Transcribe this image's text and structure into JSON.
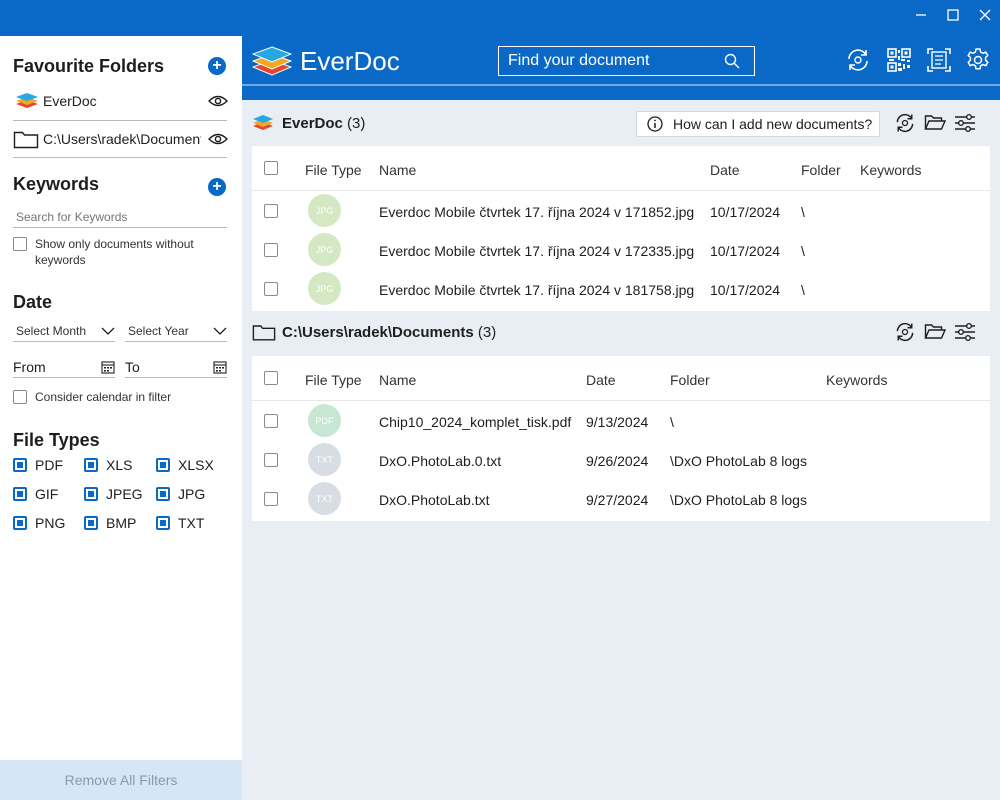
{
  "window": {
    "minimize_glyph": "—",
    "maximize_glyph": "☐",
    "close_glyph": "✕"
  },
  "sidebar": {
    "favourites_title": "Favourite Folders",
    "favourites": [
      {
        "label": "EverDoc",
        "icon": "stack-icon"
      },
      {
        "label": "C:\\Users\\radek\\Documents",
        "icon": "folder-icon"
      }
    ],
    "keywords_title": "Keywords",
    "keywords_placeholder": "Search for Keywords",
    "no_keywords_label": "Show only documents without keywords",
    "date_title": "Date",
    "select_month": "Select Month",
    "select_year": "Select Year",
    "from_label": "From",
    "to_label": "To",
    "consider_calendar": "Consider calendar in filter",
    "file_types_title": "File Types",
    "file_types": [
      "PDF",
      "XLS",
      "XLSX",
      "GIF",
      "JPEG",
      "JPG",
      "PNG",
      "BMP",
      "TXT"
    ],
    "remove_filters": "Remove All Filters"
  },
  "header": {
    "app_name": "EverDoc",
    "search_placeholder": "Find your document"
  },
  "panels": [
    {
      "title": "EverDoc",
      "count": "(3)",
      "help": "How can I add new documents?",
      "columns": [
        "File Type",
        "Name",
        "Date",
        "Folder",
        "Keywords"
      ],
      "rows": [
        {
          "type": "JPG",
          "name": "Everdoc Mobile čtvrtek 17. října 2024 v 171852.jpg",
          "date": "10/17/2024",
          "folder": "\\",
          "keywords": ""
        },
        {
          "type": "JPG",
          "name": "Everdoc Mobile čtvrtek 17. října 2024 v 172335.jpg",
          "date": "10/17/2024",
          "folder": "\\",
          "keywords": ""
        },
        {
          "type": "JPG",
          "name": "Everdoc Mobile čtvrtek 17. října 2024 v 181758.jpg",
          "date": "10/17/2024",
          "folder": "\\",
          "keywords": ""
        }
      ]
    },
    {
      "title": "C:\\Users\\radek\\Documents",
      "count": "(3)",
      "columns": [
        "File Type",
        "Name",
        "Date",
        "Folder",
        "Keywords"
      ],
      "rows": [
        {
          "type": "PDF",
          "name": "Chip10_2024_komplet_tisk.pdf",
          "date": "9/13/2024",
          "folder": "\\",
          "keywords": ""
        },
        {
          "type": "TXT",
          "name": "DxO.PhotoLab.0.txt",
          "date": "9/26/2024",
          "folder": "\\DxO PhotoLab 8 logs",
          "keywords": ""
        },
        {
          "type": "TXT",
          "name": "DxO.PhotoLab.txt",
          "date": "9/27/2024",
          "folder": "\\DxO PhotoLab 8 logs",
          "keywords": ""
        }
      ]
    }
  ],
  "colors": {
    "accent": "#0a69c7",
    "jpg_badge": "#d4e8c4",
    "pdf_badge": "#c8e6d4",
    "txt_badge": "#d8dde4"
  }
}
